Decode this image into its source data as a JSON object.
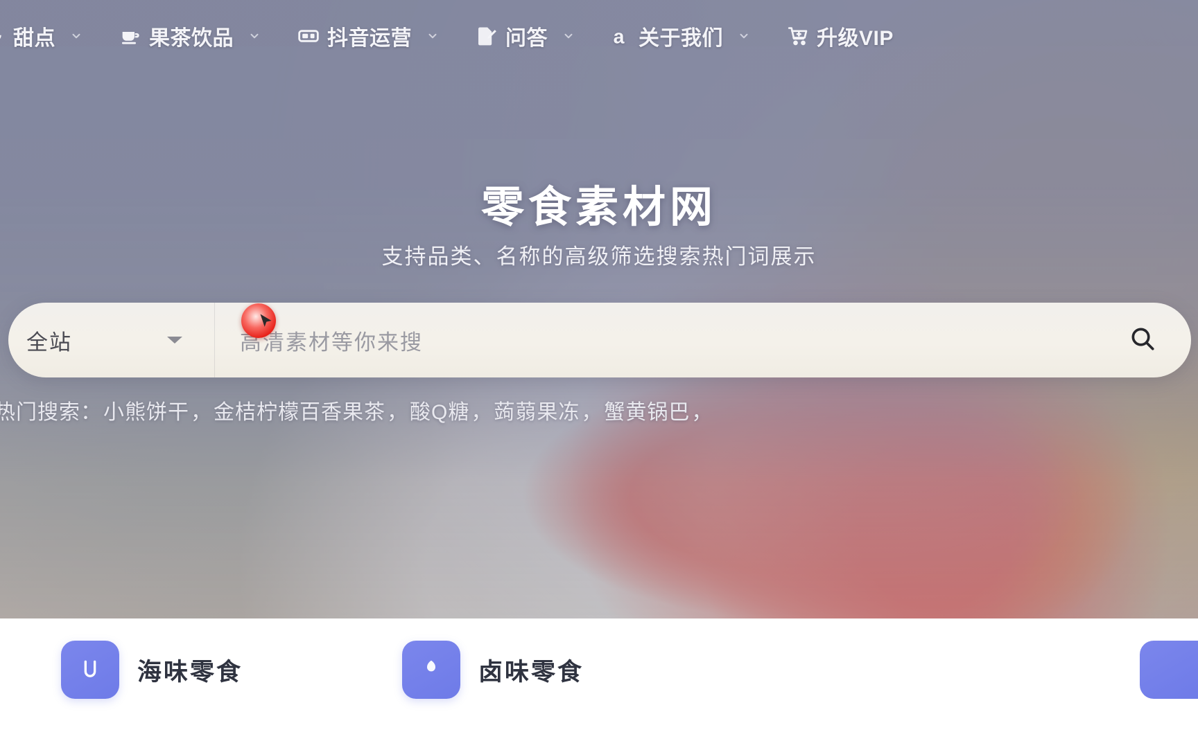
{
  "nav": {
    "items": [
      {
        "label": "甜点",
        "icon": "dessert-icon",
        "has_dropdown": true,
        "truncated": true
      },
      {
        "label": "果茶饮品",
        "icon": "cup-icon",
        "has_dropdown": true
      },
      {
        "label": "抖音运营",
        "icon": "video-card-icon",
        "has_dropdown": true
      },
      {
        "label": "问答",
        "icon": "document-pen-icon",
        "has_dropdown": true
      },
      {
        "label": "关于我们",
        "icon": "letter-a-icon",
        "has_dropdown": true
      },
      {
        "label": "升级VIP",
        "icon": "cart-plus-icon",
        "has_dropdown": false
      }
    ]
  },
  "hero": {
    "title": "零食素材网",
    "subtitle": "支持品类、名称的高级筛选搜索热门词展示"
  },
  "search": {
    "scope_label": "全站",
    "placeholder": "高清素材等你来搜",
    "value": "",
    "submit_icon": "magnifier-icon",
    "caret_icon": "chevron-down-icon"
  },
  "hot_search": {
    "label": "热门搜索：",
    "terms": [
      "小熊饼干",
      "金桔柠檬百香果茶",
      "酸Q糖",
      "蒟蒻果冻",
      "蟹黄锅巴"
    ],
    "separator": "，",
    "trailing_separator": "，"
  },
  "categories": {
    "cards": [
      {
        "title": "海味零食",
        "icon": "seafood-snack-icon"
      },
      {
        "title": "卤味零食",
        "icon": "braised-snack-icon"
      }
    ]
  },
  "colors": {
    "accent_purple": "#6e7be8",
    "scrim": "#8185a0",
    "search_bg": "#f2f0ec",
    "title_text": "#ffffff",
    "cursor_red": "#e8231b"
  }
}
